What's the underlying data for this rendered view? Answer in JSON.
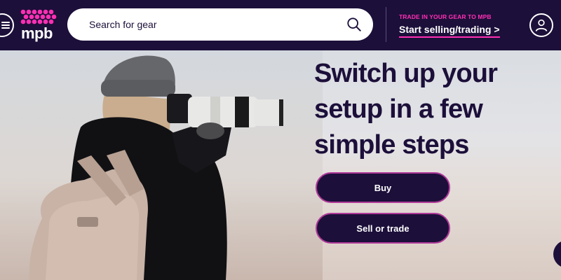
{
  "header": {
    "menu_icon": "hamburger-menu-icon",
    "logo_text": "mpb",
    "search": {
      "placeholder": "Search for gear",
      "icon": "search-icon"
    },
    "trade_eyebrow": "TRADE IN YOUR GEAR TO MPB",
    "trade_link": "Start selling/trading >",
    "account_icon": "user-account-icon"
  },
  "hero": {
    "headline": "Switch up your setup in a few simple steps",
    "buy_label": "Buy",
    "sell_label": "Sell or trade"
  },
  "colors": {
    "navy": "#1c0f3a",
    "brand_pink": "#ff2fb3",
    "white": "#ffffff"
  }
}
